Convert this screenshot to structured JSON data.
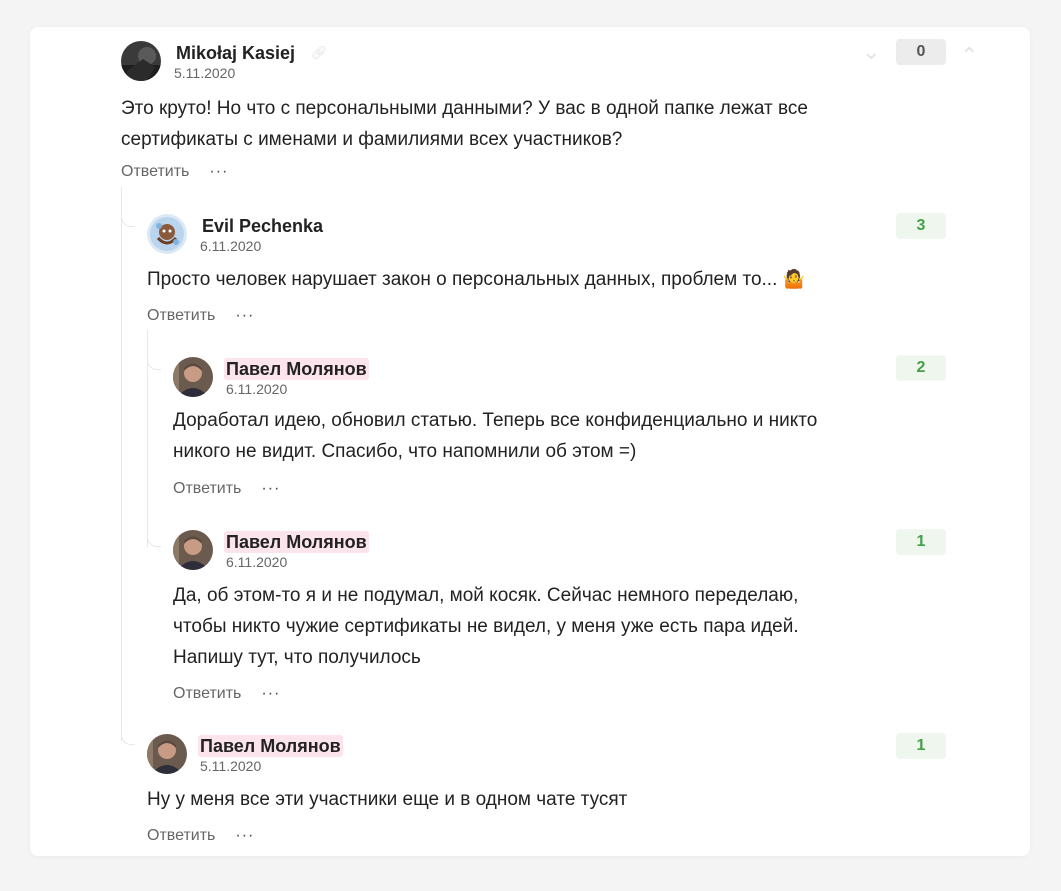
{
  "comments": [
    {
      "author": "Mikołaj Kasiej",
      "date": "5.11.2020",
      "text_lines": [
        "Это круто! Но что с персональными данными? У вас в одной папке лежат все",
        "сертификаты с именами и фамилиями всех участников?"
      ],
      "score": "0",
      "reply_label": "Ответить",
      "more_label": "···"
    },
    {
      "author": "Evil Pechenka",
      "date": "6.11.2020",
      "text_lines": [
        "Просто человек нарушает закон о персональных данных, проблем то... "
      ],
      "emoji": "🤷",
      "score": "3",
      "reply_label": "Ответить",
      "more_label": "···"
    },
    {
      "author": "Павел Молянов",
      "date": "6.11.2020",
      "text_lines": [
        "Доработал идею, обновил статью. Теперь все конфиденциально и никто",
        "никого не видит. Спасибо, что напомнили об этом =)"
      ],
      "score": "2",
      "reply_label": "Ответить",
      "more_label": "···"
    },
    {
      "author": "Павел Молянов",
      "date": "6.11.2020",
      "text_lines": [
        "Да, об этом-то я и не подумал, мой косяк. Сейчас немного переделаю,",
        "чтобы никто чужие сертификаты не видел, у меня уже есть пара идей.",
        "Напишу тут, что получилось"
      ],
      "score": "1",
      "reply_label": "Ответить",
      "more_label": "···"
    },
    {
      "author": "Павел Молянов",
      "date": "5.11.2020",
      "text_lines": [
        "Ну у меня все эти участники еще и в одном чате тусят"
      ],
      "score": "1",
      "reply_label": "Ответить",
      "more_label": "···"
    }
  ],
  "icons": {
    "link": "link-icon",
    "vote_down": "chevron-down-icon",
    "vote_up": "chevron-up-icon"
  },
  "colors": {
    "score_positive": "#43a047",
    "author_highlight": "#fce4ec"
  }
}
